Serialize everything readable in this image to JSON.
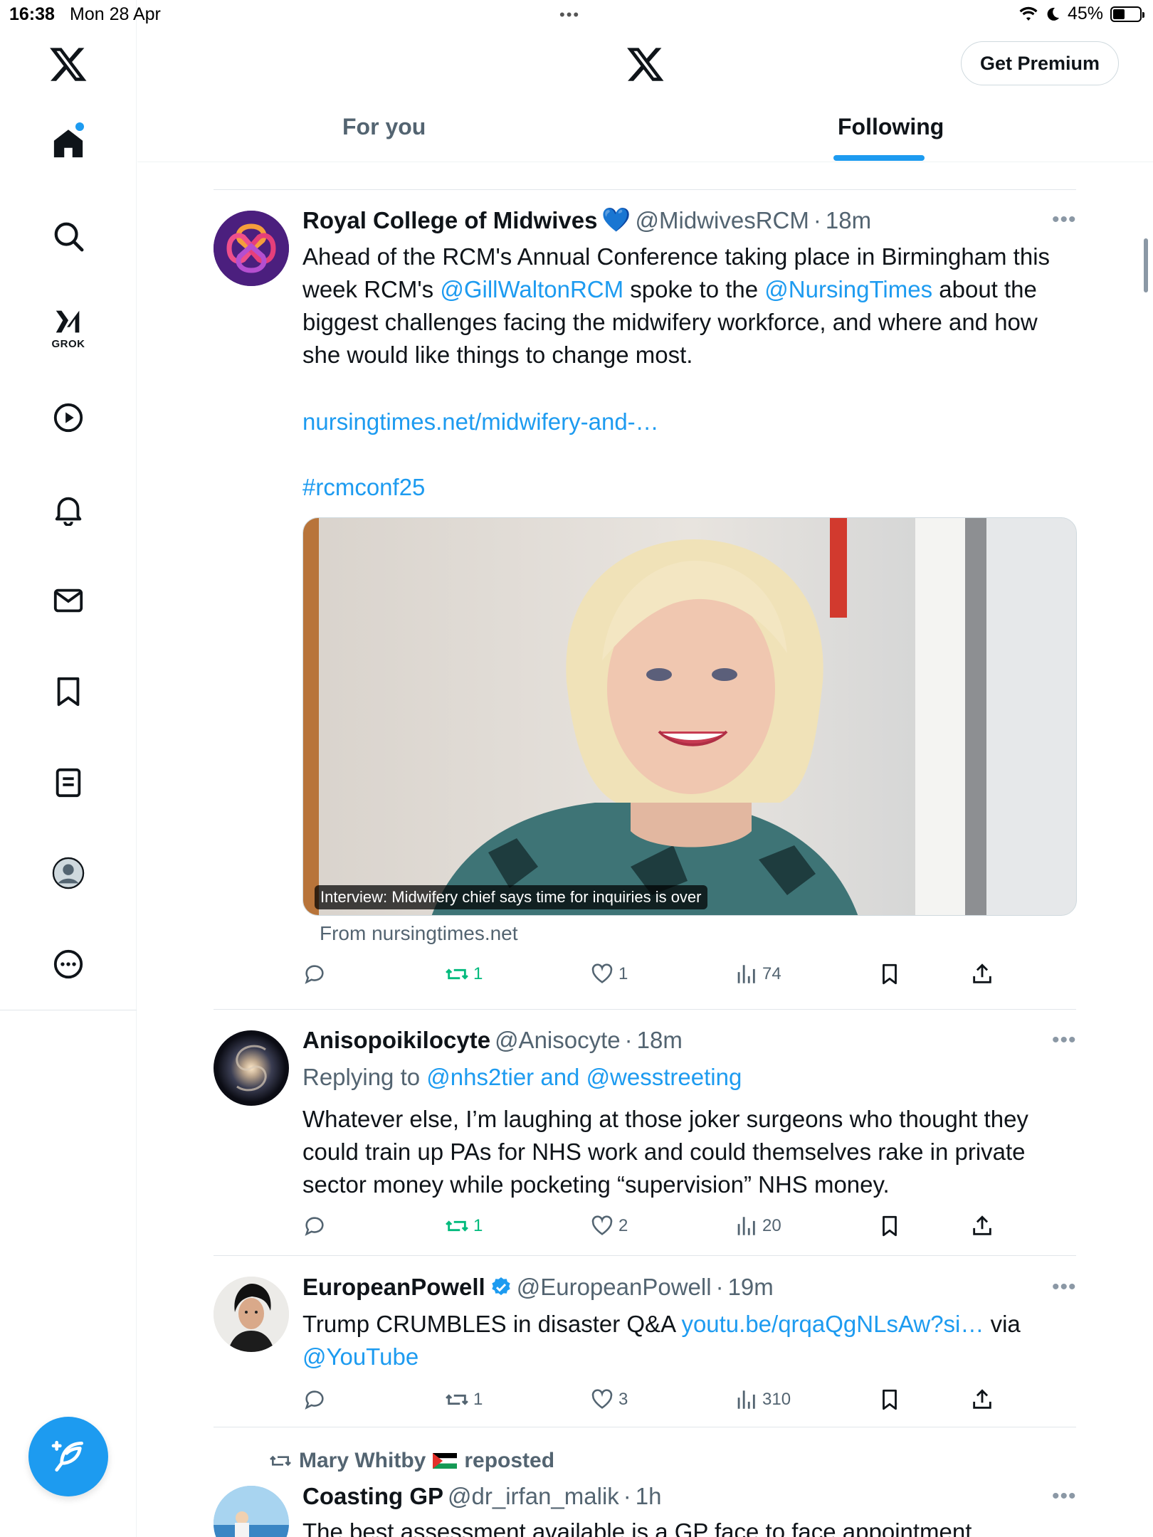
{
  "status_bar": {
    "time": "16:38",
    "date": "Mon 28 Apr",
    "battery": "45%",
    "battery_level": 0.45
  },
  "sidebar": {
    "items": [
      {
        "name": "home",
        "icon": "home-icon"
      },
      {
        "name": "explore",
        "icon": "search-icon"
      },
      {
        "name": "grok",
        "icon": "grok-icon",
        "label": "GROK"
      },
      {
        "name": "videos",
        "icon": "play-icon"
      },
      {
        "name": "notifications",
        "icon": "bell-icon"
      },
      {
        "name": "messages",
        "icon": "mail-icon"
      },
      {
        "name": "bookmarks",
        "icon": "bookmark-icon"
      },
      {
        "name": "lists",
        "icon": "list-icon"
      },
      {
        "name": "profile",
        "icon": "profile-icon"
      },
      {
        "name": "more",
        "icon": "more-icon"
      }
    ]
  },
  "header": {
    "premium_label": "Get Premium",
    "tabs": [
      {
        "label": "For you",
        "active": false
      },
      {
        "label": "Following",
        "active": true
      }
    ]
  },
  "colors": {
    "accent": "#1d9bf0",
    "repost_green": "#00ba7c",
    "secondary_text": "#536471"
  },
  "posts": [
    {
      "name": "Royal College of Midwives",
      "emoji": "💙",
      "handle": "@MidwivesRCM",
      "time": "18m",
      "text_1": "Ahead of the RCM's Annual Conference taking place in Birmingham this week RCM's ",
      "mention_1": "@GillWaltonRCM",
      "text_2": " spoke to the ",
      "mention_2": "@NursingTimes",
      "text_3": " about the biggest challenges facing the midwifery workforce, and where and how she would like things to change most.",
      "link": "nursingtimes.net/midwifery-and-…",
      "hashtag": "#rcmconf25",
      "card_caption": "Interview: Midwifery chief says time for inquiries is over",
      "card_source": "From nursingtimes.net",
      "stats": {
        "replies": "",
        "reposts": "1",
        "likes": "1",
        "views": "74"
      }
    },
    {
      "name": "Anisopoikilocyte",
      "handle": "@Anisocyte",
      "time": "18m",
      "replying_prefix": "Replying to ",
      "replying_to": "@nhs2tier and @wesstreeting",
      "text": "Whatever else, I’m laughing at those joker surgeons who thought they could train up PAs for NHS work and could themselves rake in private sector money while pocketing “supervision” NHS money.",
      "stats": {
        "replies": "",
        "reposts": "1",
        "likes": "2",
        "views": "20"
      }
    },
    {
      "name": "EuropeanPowell",
      "verified": true,
      "handle": "@EuropeanPowell",
      "time": "19m",
      "text_1": "Trump CRUMBLES in disaster Q&A ",
      "link": "youtu.be/qrqaQgNLsAw?si…",
      "text_2": " via ",
      "mention": "@YouTube",
      "stats": {
        "replies": "",
        "reposts": "1",
        "likes": "3",
        "views": "310"
      }
    },
    {
      "reposted_by": "Mary Whitby",
      "reposted_suffix": "reposted",
      "name": "Coasting GP",
      "handle": "@dr_irfan_malik",
      "time": "1h",
      "text": "The best assessment available is a GP face to face appointment"
    }
  ]
}
